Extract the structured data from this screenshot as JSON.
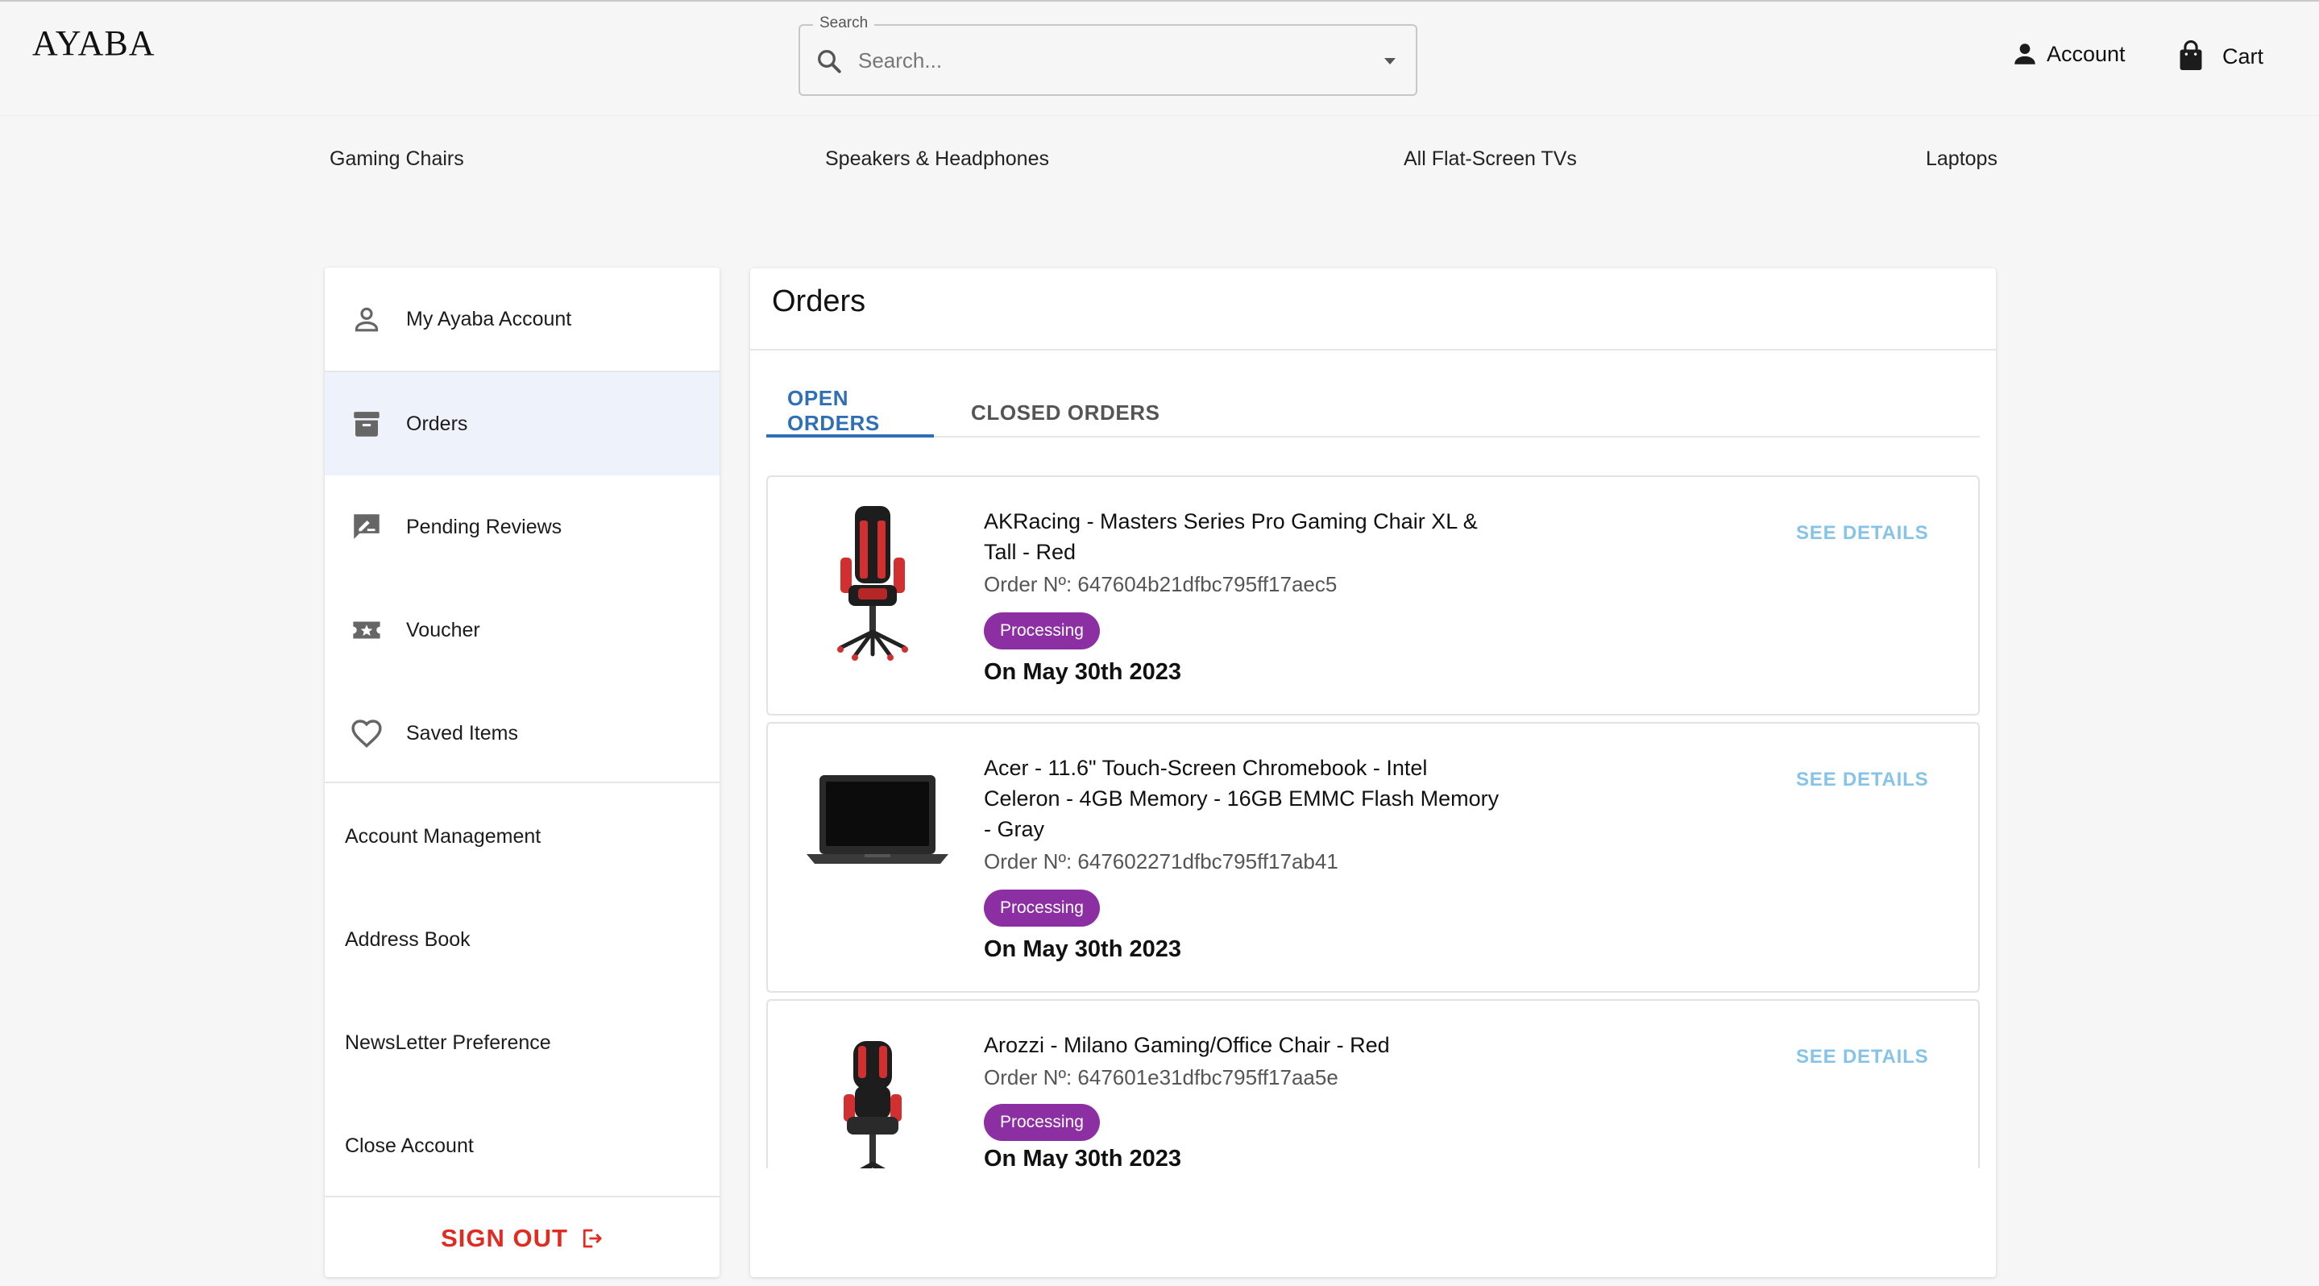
{
  "header": {
    "logo": "AYABA",
    "search": {
      "legend": "Search",
      "placeholder": "Search..."
    },
    "account_label": "Account",
    "cart_label": "Cart"
  },
  "categories": [
    "Gaming Chairs",
    "Speakers & Headphones",
    "All Flat-Screen TVs",
    "Laptops"
  ],
  "sidebar": {
    "items": [
      {
        "label": "My Ayaba Account",
        "icon": "person-outline-icon"
      },
      {
        "label": "Orders",
        "icon": "archive-box-icon",
        "active": true
      },
      {
        "label": "Pending Reviews",
        "icon": "rate-review-icon"
      },
      {
        "label": "Voucher",
        "icon": "ticket-star-icon"
      },
      {
        "label": "Saved Items",
        "icon": "heart-outline-icon"
      }
    ],
    "links": [
      "Account Management",
      "Address Book",
      "NewsLetter Preference",
      "Close Account"
    ],
    "signout_label": "SIGN OUT"
  },
  "main": {
    "title": "Orders",
    "tabs": [
      {
        "label": "OPEN ORDERS",
        "active": true
      },
      {
        "label": "CLOSED ORDERS",
        "active": false
      }
    ],
    "orders": [
      {
        "title": "AKRacing - Masters Series Pro Gaming Chair XL & Tall - Red",
        "order_no": "Order Nº: 647604b21dfbc795ff17aec5",
        "status": "Processing",
        "date": "On May 30th 2023",
        "action": "SEE DETAILS",
        "image": "gaming-chair-red"
      },
      {
        "title": "Acer - 11.6\" Touch-Screen Chromebook - Intel Celeron - 4GB Memory - 16GB EMMC Flash Memory - Gray",
        "order_no": "Order Nº: 647602271dfbc795ff17ab41",
        "status": "Processing",
        "date": "On May 30th 2023",
        "action": "SEE DETAILS",
        "image": "chromebook-laptop"
      },
      {
        "title": "Arozzi - Milano Gaming/Office Chair - Red",
        "order_no": "Order Nº: 647601e31dfbc795ff17aa5e",
        "status": "Processing",
        "date": "On May 30th 2023",
        "action": "SEE DETAILS",
        "image": "office-chair-red"
      }
    ]
  },
  "colors": {
    "accent_blue": "#2f6fb5",
    "badge_purple": "#8c2fa3",
    "signout_red": "#e02b20",
    "details_blue": "#86c3e8",
    "active_bg": "#eef3fb"
  }
}
